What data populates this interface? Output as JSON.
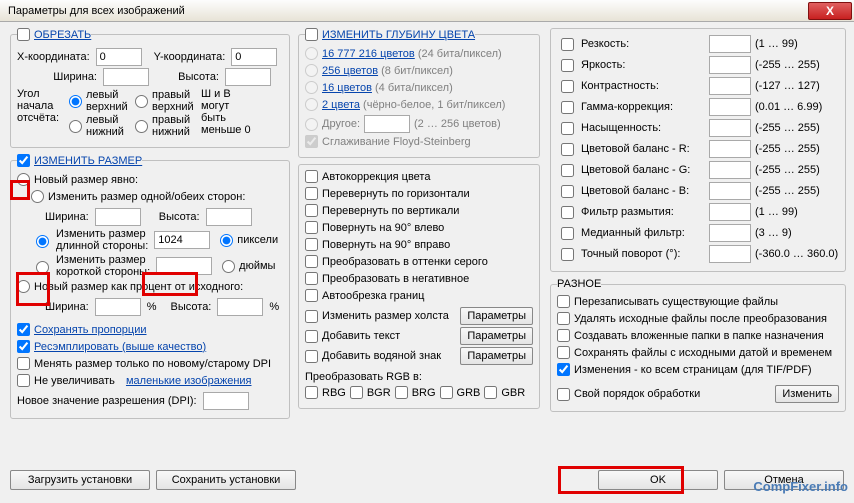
{
  "window": {
    "title": "Параметры для всех изображений",
    "close": "X"
  },
  "crop": {
    "title": "ОБРЕЗАТЬ",
    "xcoord": "X-координата:",
    "xval": "0",
    "ycoord": "Y-координата:",
    "yval": "0",
    "width": "Ширина:",
    "wval": "",
    "height": "Высота:",
    "hval": "",
    "angle_title": "Угол начала отсчёта:",
    "lv": "левый верхний",
    "pv": "правый верхний",
    "ln": "левый нижний",
    "pn": "правый нижний",
    "wh_note1": "Ш и В",
    "wh_note2": "могут",
    "wh_note3": "быть",
    "wh_note4": "меньше 0"
  },
  "resize": {
    "title": "ИЗМЕНИТЬ РАЗМЕР",
    "new_explicit": "Новый размер явно:",
    "change_both": "Изменить размер одной/обеих сторон:",
    "width": "Ширина:",
    "wval": "",
    "height": "Высота:",
    "hval": "",
    "long_side1": "Изменить размер",
    "long_side2": "длинной стороны:",
    "long_val": "1024",
    "short_side1": "Изменить размер",
    "short_side2": "короткой стороны:",
    "short_val": "",
    "pixels": "пиксели",
    "inches": "дюймы",
    "as_percent": "Новый размер как процент от исходного:",
    "pw": "Ширина:",
    "pwv": "",
    "pct": "%",
    "ph": "Высота:",
    "phv": "",
    "keep_ratio": "Сохранять пропорции",
    "resample": "Ресэмплировать (выше качество)",
    "old_new_dpi": "Менять размер только по новому/старому DPI",
    "old_new_dpi_link": "DPI",
    "no_enlarge": "Не увеличивать",
    "no_enlarge_link": "маленькие изображения",
    "new_dpi": "Новое значение разрешения (DPI):",
    "new_dpi_val": ""
  },
  "depth": {
    "title": "ИЗМЕНИТЬ ГЛУБИНУ ЦВЕТА",
    "c16m": "16 777 216 цветов",
    "c16m_b": "(24 бита/пиксел)",
    "c256": "256 цветов",
    "c256_b": "(8 бит/пиксел)",
    "c16": "16 цветов",
    "c16_b": "(4 бита/пиксел)",
    "c2": "2 цвета",
    "c2_b": "(чёрно-белое, 1 бит/пиксел)",
    "other": "Другое:",
    "other_b": "(2 … 256 цветов)",
    "other_val": "",
    "floyd": "Сглаживание Floyd-Steinberg"
  },
  "ops": {
    "autocolor": "Автокоррекция цвета",
    "fliph": "Перевернуть по горизонтали",
    "flipv": "Перевернуть по вертикали",
    "rotl": "Повернуть на 90° влево",
    "rotr": "Повернуть на 90° вправо",
    "gray": "Преобразовать в оттенки серого",
    "neg": "Преобразовать в негативное",
    "autocrop": "Автообрезка границ",
    "canvas": "Изменить размер холста",
    "text": "Добавить текст",
    "watermark": "Добавить водяной знак",
    "params_btn": "Параметры",
    "rgb_title": "Преобразовать RGB в:",
    "rgb": [
      "RBG",
      "BGR",
      "BRG",
      "GRB",
      "GBR"
    ]
  },
  "adj": {
    "sharp": "Резкость:",
    "sharp_r": "(1 … 99)",
    "bright": "Яркость:",
    "bright_r": "(-255 … 255)",
    "contrast": "Контрастность:",
    "contrast_r": "(-127 … 127)",
    "gamma": "Гамма-коррекция:",
    "gamma_r": "(0.01 … 6.99)",
    "sat": "Насыщенность:",
    "sat_r": "(-255 … 255)",
    "r": "Цветовой баланс - R:",
    "r_r": "(-255 … 255)",
    "g": "Цветовой баланс - G:",
    "g_r": "(-255 … 255)",
    "b": "Цветовой баланс - B:",
    "b_r": "(-255 … 255)",
    "blur": "Фильтр размытия:",
    "blur_r": "(1 … 99)",
    "median": "Медианный фильтр:",
    "median_r": "(3 … 9)",
    "rotate": "Точный поворот (°):",
    "rotate_r": "(-360.0 … 360.0)"
  },
  "misc": {
    "title": "РАЗНОЕ",
    "overwrite": "Перезаписывать существующие файлы",
    "delsrc": "Удалять исходные файлы после преобразования",
    "subdirs": "Создавать вложенные папки в папке назначения",
    "savedate": "Сохранять файлы с исходными датой и временем",
    "allpages": "Изменения - ко всем страницам (для TIF/PDF)",
    "ownorder": "Свой порядок обработки",
    "change_btn": "Изменить"
  },
  "bottom": {
    "load": "Загрузить установки",
    "save": "Сохранить установки",
    "ok": "OK",
    "cancel": "Отмена"
  },
  "watermark": "CompFixer.info"
}
